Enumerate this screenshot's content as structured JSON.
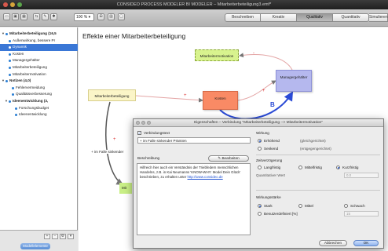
{
  "window": {
    "title": "CONSIDEO PROCESS MODELER BI MODELER – Mitarbeiterbeteiligung3.emf*"
  },
  "toolbar": {
    "zoom": "100 %",
    "icons": [
      "folder-icon",
      "save-icon",
      "grid-icon",
      "link-icon",
      "pencil-icon",
      "star-icon",
      "zoom-select",
      "grid-view-icon",
      "table-icon",
      "window-icon"
    ],
    "view_tabs": [
      {
        "label": "Beschreiben",
        "active": false
      },
      {
        "label": "Kreativ",
        "active": false
      },
      {
        "label": "Qualitativ",
        "active": true
      },
      {
        "label": "Quantitativ",
        "active": false
      },
      {
        "label": "Simulieren",
        "active": false
      }
    ]
  },
  "sidebar": {
    "items": [
      {
        "label": "Mitarbeiterbeteiligung (16,5",
        "level": 0,
        "bold": true,
        "selected": false
      },
      {
        "label": "Außenwirkung, bessere Pr",
        "level": 1,
        "bold": false,
        "selected": false
      },
      {
        "label": "Dynamik",
        "level": 1,
        "bold": false,
        "selected": true
      },
      {
        "label": "Kosten",
        "level": 1,
        "bold": false,
        "selected": false
      },
      {
        "label": "Managergehälter",
        "level": 1,
        "bold": false,
        "selected": false
      },
      {
        "label": "Mitarbeiterbeteiligung",
        "level": 1,
        "bold": false,
        "selected": false
      },
      {
        "label": "Mitarbeitermotivation",
        "level": 1,
        "bold": false,
        "selected": false
      },
      {
        "label": "Notizen (4,0)",
        "level": 0,
        "bold": true,
        "selected": false
      },
      {
        "label": "Fehlervermeidung",
        "level": 2,
        "bold": false,
        "selected": false
      },
      {
        "label": "Qualitätsverbesserung",
        "level": 2,
        "bold": false,
        "selected": false
      },
      {
        "label": "Ideenentwicklung (3,",
        "level": 1,
        "bold": true,
        "selected": false
      },
      {
        "label": "Forschungsbudget",
        "level": 2,
        "bold": false,
        "selected": false
      },
      {
        "label": "Ideenentwicklung",
        "level": 2,
        "bold": false,
        "selected": false
      }
    ],
    "bottom_tab": "Modellelemente"
  },
  "canvas": {
    "title": "Effekte einer Mitarbeiterbeteiligung",
    "nodes": {
      "mitarbeitermotivation": "Mitarbeitermotivation",
      "managergehaelter": "Managergehälter",
      "kosten": "Kosten",
      "mitarbeiterbeteiligung": "Mitarbeiterbeteiligung",
      "green_partial": "Mit"
    },
    "edge_label_fall": "+ im Falle sinkender",
    "loop_label": "B",
    "plus_signs": [
      "+",
      "+",
      "-",
      "+"
    ]
  },
  "dialog": {
    "title": "Eigenschaften – Verbindung \"Mitarbeiterbeteiligung --> Mitarbeitermotivation\"",
    "connection_text_label": "Verbindungstext",
    "connection_text_checked": true,
    "connection_text_value": "+ im Falle sinkender Prämien",
    "description_label": "Beschreibung",
    "edit_button": "Bearbeiten",
    "description_text": "Hilfreich hier auch ein Verständnis der Triebfedern menschlichen Handelns, z.B. in Kai Neumanns 'KNOW-WHY: Model Dein Glück' beschrieben, zu erhalten unter",
    "description_url": "http://www.consideo.de",
    "wirkung": {
      "title": "Wirkung",
      "options": [
        {
          "label": "Erhöhend",
          "hint": "(gleichgerichtet)",
          "selected": true
        },
        {
          "label": "Senkend",
          "hint": "(entgegengerichtet)",
          "selected": false
        }
      ]
    },
    "zeitverzoegerung": {
      "title": "Zeitverzögerung",
      "options": [
        {
          "label": "Langfristig",
          "selected": false
        },
        {
          "label": "Mittelfristig",
          "selected": false
        },
        {
          "label": "Kurzfristig",
          "selected": true
        }
      ],
      "quant_label": "Quantitativer Wert",
      "quant_value": "0.0"
    },
    "wirkungsstaerke": {
      "title": "Wirkungsstärke",
      "options": [
        {
          "label": "Stark",
          "selected": true
        },
        {
          "label": "Mittel",
          "selected": false
        },
        {
          "label": "Schwach",
          "selected": false
        }
      ],
      "custom_label": "Benutzerdefiniert [%]",
      "custom_value": "15"
    },
    "cancel_button": "Abbrechen",
    "ok_button": "OK"
  }
}
